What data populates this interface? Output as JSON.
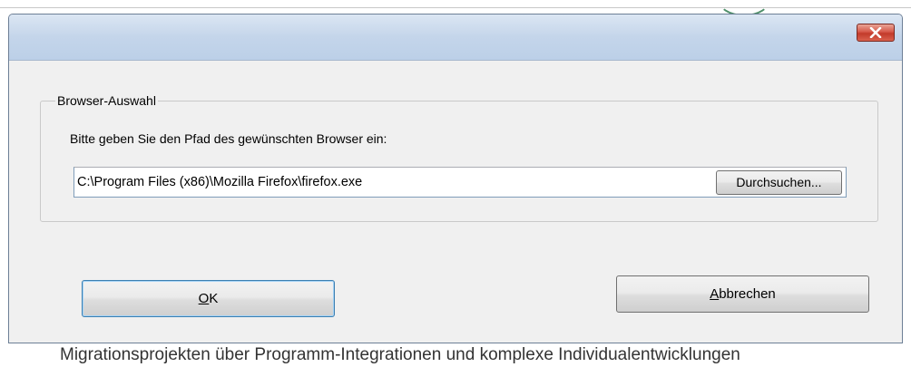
{
  "background": {
    "text": "Migrationsprojekten über Programm-Integrationen und komplexe Individualentwicklungen"
  },
  "dialog": {
    "close_icon": "close-icon",
    "group_title": "Browser-Auswahl",
    "prompt": "Bitte geben Sie den Pfad des gewünschten Browser ein:",
    "path_value": "C:\\Program Files (x86)\\Mozilla Firefox\\firefox.exe",
    "browse_label": "Durchsuchen...",
    "ok_mnemonic": "O",
    "ok_rest": "K",
    "cancel_mnemonic": "A",
    "cancel_rest": "bbrechen"
  },
  "colors": {
    "close_button": "#c94a3a",
    "title_bar": "#c8d8ec",
    "client": "#f0f0f0"
  }
}
